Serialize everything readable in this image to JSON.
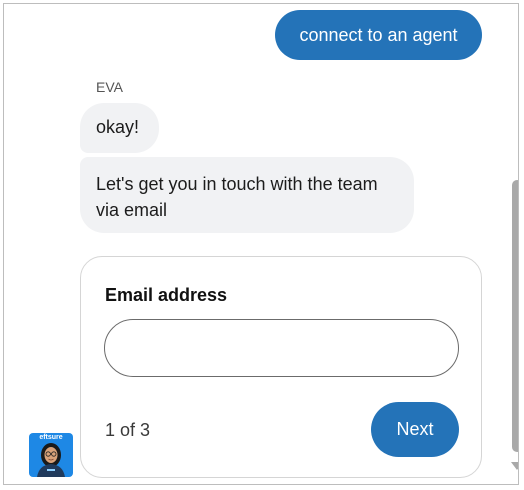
{
  "colors": {
    "accent": "#2473b8",
    "bot_bubble_bg": "#f1f2f4",
    "avatar_bg": "#1e88e5"
  },
  "conversation": {
    "user_message": "connect to an agent",
    "agent_name": "EVA",
    "bot_messages": [
      "okay!",
      "Let's get you in touch with the team via email"
    ]
  },
  "form": {
    "label": "Email address",
    "email_value": "",
    "step": "1 of 3",
    "next_label": "Next"
  },
  "avatar": {
    "logo_text": "eftsure",
    "icon": "agent-avatar-icon"
  }
}
